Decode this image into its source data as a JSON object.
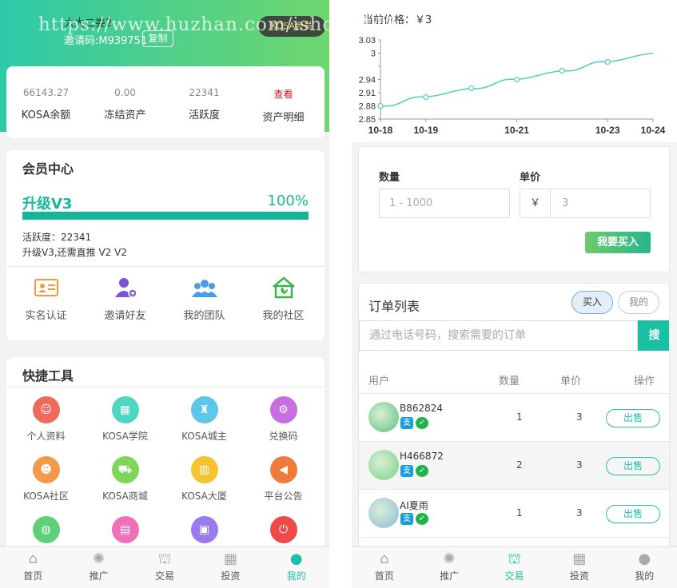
{
  "watermark": "https://www.huzhan.com/ishop4443",
  "left": {
    "header": {
      "user_name": "大大二娄2",
      "invite": "邀请码:M939751",
      "copy_label": "复制",
      "badge": "KOSA会员"
    },
    "stats": [
      {
        "value": "66143.27",
        "label": "KOSA余额"
      },
      {
        "value": "0.00",
        "label": "冻结资产"
      },
      {
        "value": "22341",
        "label": "活跃度"
      },
      {
        "value": "查看",
        "label": "资产明细"
      }
    ],
    "member": {
      "title": "会员中心",
      "level_label": "升级V3",
      "progress_text": "100%",
      "progress": 1.0,
      "activity": "活跃度：22341",
      "upgrade_note": "升级V3,还需直推 V2  V2",
      "actions": [
        {
          "icon": "id-card-icon",
          "label": "实名认证"
        },
        {
          "icon": "add-user-icon",
          "label": "邀请好友"
        },
        {
          "icon": "team-icon",
          "label": "我的团队"
        },
        {
          "icon": "community-home-icon",
          "label": "我的社区"
        }
      ]
    },
    "tools": {
      "title": "快捷工具",
      "items": [
        {
          "icon": "profile-icon",
          "label": "个人资料",
          "color": "#ef6a5e"
        },
        {
          "icon": "school-icon",
          "label": "KOSA学院",
          "color": "#4fd6c3"
        },
        {
          "icon": "castle-icon",
          "label": "KOSA城主",
          "color": "#5ec6e8"
        },
        {
          "icon": "redeem-icon",
          "label": "兑换码",
          "color": "#c76fe0"
        },
        {
          "icon": "community-icon",
          "label": "KOSA社区",
          "color": "#f29a4a"
        },
        {
          "icon": "cart-icon",
          "label": "KOSA商城",
          "color": "#7fd65a"
        },
        {
          "icon": "building-icon",
          "label": "KOSA大厦",
          "color": "#f5c430"
        },
        {
          "icon": "megaphone-icon",
          "label": "平台公告",
          "color": "#f07a3c"
        },
        {
          "icon": "globe-icon",
          "label": "",
          "color": "#5fcf7a"
        },
        {
          "icon": "document-icon",
          "label": "",
          "color": "#f070b8"
        },
        {
          "icon": "lock-icon",
          "label": "",
          "color": "#9a7af0"
        },
        {
          "icon": "power-icon",
          "label": "",
          "color": "#ef4a4a"
        }
      ]
    },
    "tabbar": [
      {
        "icon": "home-icon",
        "label": "首页",
        "active": false
      },
      {
        "icon": "promote-icon",
        "label": "推广",
        "active": false
      },
      {
        "icon": "bank-icon",
        "label": "交易",
        "active": false
      },
      {
        "icon": "invest-icon",
        "label": "投资",
        "active": false
      },
      {
        "icon": "user-icon",
        "label": "我的",
        "active": true
      }
    ]
  },
  "right": {
    "price_label": "当前价格：￥3",
    "chart_data": {
      "type": "line",
      "title": "",
      "x_ticks": [
        "10-18",
        "10-19",
        "10-21",
        "10-23",
        "10-24"
      ],
      "y_ticks": [
        2.85,
        2.88,
        2.91,
        2.94,
        2.97,
        3.0,
        3.03
      ],
      "y_tick_labels": [
        "2.85",
        "2.88",
        "2.91",
        "2.94",
        "",
        "3",
        "3.03"
      ],
      "ylim": [
        2.85,
        3.03
      ],
      "points": [
        {
          "x": "10-18",
          "y": 2.88
        },
        {
          "x": "10-19",
          "y": 2.9
        },
        {
          "x": "10-20",
          "y": 2.92
        },
        {
          "x": "10-21",
          "y": 2.94
        },
        {
          "x": "10-22",
          "y": 2.96
        },
        {
          "x": "10-23",
          "y": 2.98
        },
        {
          "x": "10-24",
          "y": 3.0
        }
      ],
      "color": "#55cfc0"
    },
    "buy_form": {
      "qty_label": "数量",
      "qty_placeholder": "1 - 1000",
      "price_label": "单价",
      "currency": "￥",
      "price_value": "3",
      "buy_button": "我要买入"
    },
    "orders": {
      "title": "订单列表",
      "tab_buy": "买入",
      "tab_mine": "我的",
      "search_placeholder": "通过电话号码，搜索需要的订单",
      "search_button": "搜",
      "headers": {
        "user": "用户",
        "qty": "数量",
        "price": "单价",
        "op": "操作"
      },
      "rows": [
        {
          "name": "B862824",
          "qty": "1",
          "price": "3",
          "action": "出售"
        },
        {
          "name": "H466872",
          "qty": "2",
          "price": "3",
          "action": "出售"
        },
        {
          "name": "AI夏雨",
          "qty": "1",
          "price": "3",
          "action": "出售"
        }
      ],
      "pay_alipay": "支",
      "pay_wechat": "✓"
    },
    "tabbar": [
      {
        "icon": "home-icon",
        "label": "首页",
        "active": false
      },
      {
        "icon": "promote-icon",
        "label": "推广",
        "active": false
      },
      {
        "icon": "bank-icon",
        "label": "交易",
        "active": true
      },
      {
        "icon": "invest-icon",
        "label": "投资",
        "active": false
      },
      {
        "icon": "user-icon",
        "label": "我的",
        "active": false
      }
    ]
  }
}
